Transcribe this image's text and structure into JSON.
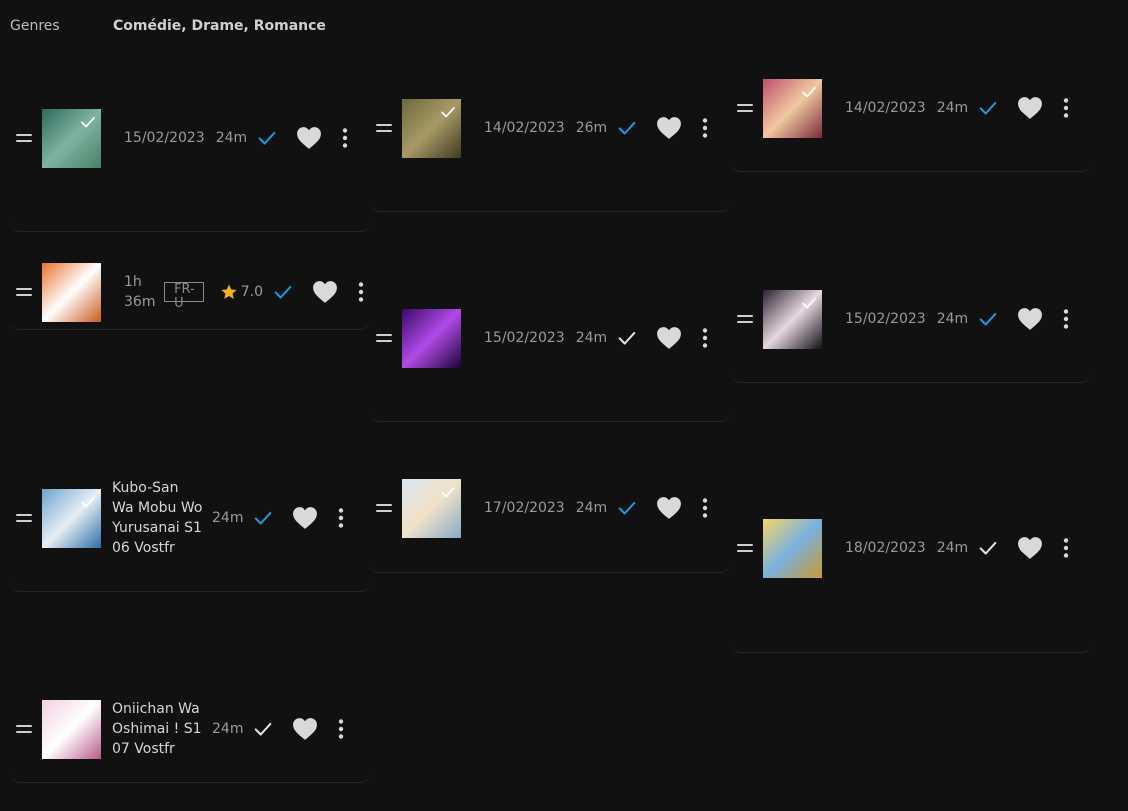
{
  "genres": {
    "label": "Genres",
    "value": "Comédie, Drame, Romance"
  },
  "episodes": [
    {
      "id": "c1r1",
      "date": "15/02/2023",
      "duration": "24m",
      "watched_color": "#1e9be0",
      "thumb": [
        "#2e6a5a",
        "#7fb3a3",
        "#4a7f66"
      ]
    },
    {
      "id": "c1r2",
      "runtime": "1h 36m",
      "badge": "FR-U",
      "rating": "7.0",
      "watched_color": "#1e9be0",
      "thumb": [
        "#e8722a",
        "#ffffff",
        "#c85a1a"
      ]
    },
    {
      "id": "c1r3",
      "title": "Kubo-San Wa Mobu Wo Yurusanai S1 06 Vostfr",
      "duration": "24m",
      "watched_color": "#1e9be0",
      "thumb": [
        "#6aa3cf",
        "#e8eef4",
        "#2a6fa8"
      ]
    },
    {
      "id": "c1r4",
      "title": "Oniichan Wa Oshimai ! S1 07 Vostfr",
      "duration": "24m",
      "watched_color": "#e6e6e6",
      "thumb": [
        "#f2d0e2",
        "#ffffff",
        "#b85a8a"
      ]
    },
    {
      "id": "c2r1",
      "date": "14/02/2023",
      "duration": "26m",
      "watched_color": "#1e9be0",
      "thumb": [
        "#6b6a3a",
        "#a89a66",
        "#3e3b22"
      ]
    },
    {
      "id": "c2r2",
      "date": "15/02/2023",
      "duration": "24m",
      "watched_color": "#e6e6e6",
      "thumb": [
        "#3b0a6a",
        "#b04ae8",
        "#1c0535"
      ]
    },
    {
      "id": "c2r3",
      "date": "17/02/2023",
      "duration": "24m",
      "watched_color": "#1e9be0",
      "thumb": [
        "#d8e6f0",
        "#f0e2c8",
        "#8aa8c8"
      ]
    },
    {
      "id": "c3r1",
      "date": "14/02/2023",
      "duration": "24m",
      "watched_color": "#1e9be0",
      "thumb": [
        "#c0506a",
        "#f0c8a0",
        "#7a2a3a"
      ]
    },
    {
      "id": "c3r2",
      "date": "15/02/2023",
      "duration": "24m",
      "watched_color": "#1e9be0",
      "thumb": [
        "#2a2230",
        "#e8d8e0",
        "#111018"
      ]
    },
    {
      "id": "c3r3",
      "date": "18/02/2023",
      "duration": "24m",
      "watched_color": "#e6e6e6",
      "thumb": [
        "#f2d860",
        "#7ab0e0",
        "#c89a30"
      ]
    }
  ],
  "colors": {
    "background": "#111111",
    "heart": "#d9d9d9",
    "star": "#f5b021",
    "text_muted": "#9a9a9a"
  }
}
